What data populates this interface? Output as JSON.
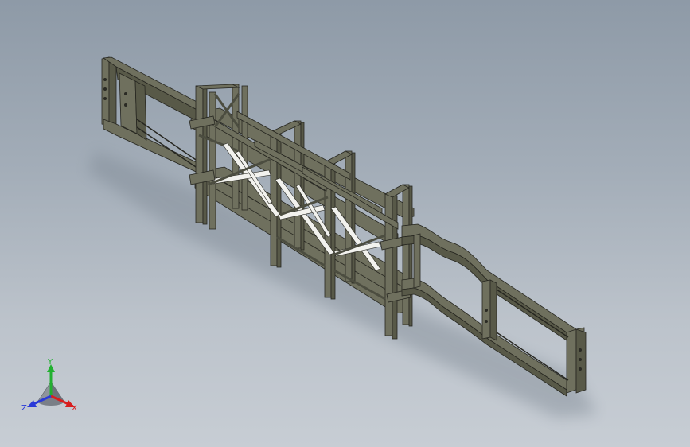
{
  "viewport": {
    "background_top": "#8e9aa7",
    "background_bottom": "#c7cdd4"
  },
  "model": {
    "frame_color": "#6f705e",
    "edge_color": "#262620",
    "highlight_color": "#f2f2ee",
    "shadow_color": "#7f8994"
  },
  "triad": {
    "x_label": "X",
    "y_label": "Y",
    "z_label": "Z",
    "x_color": "#d81e1e",
    "y_color": "#22b030",
    "z_color": "#2a3ad8"
  }
}
